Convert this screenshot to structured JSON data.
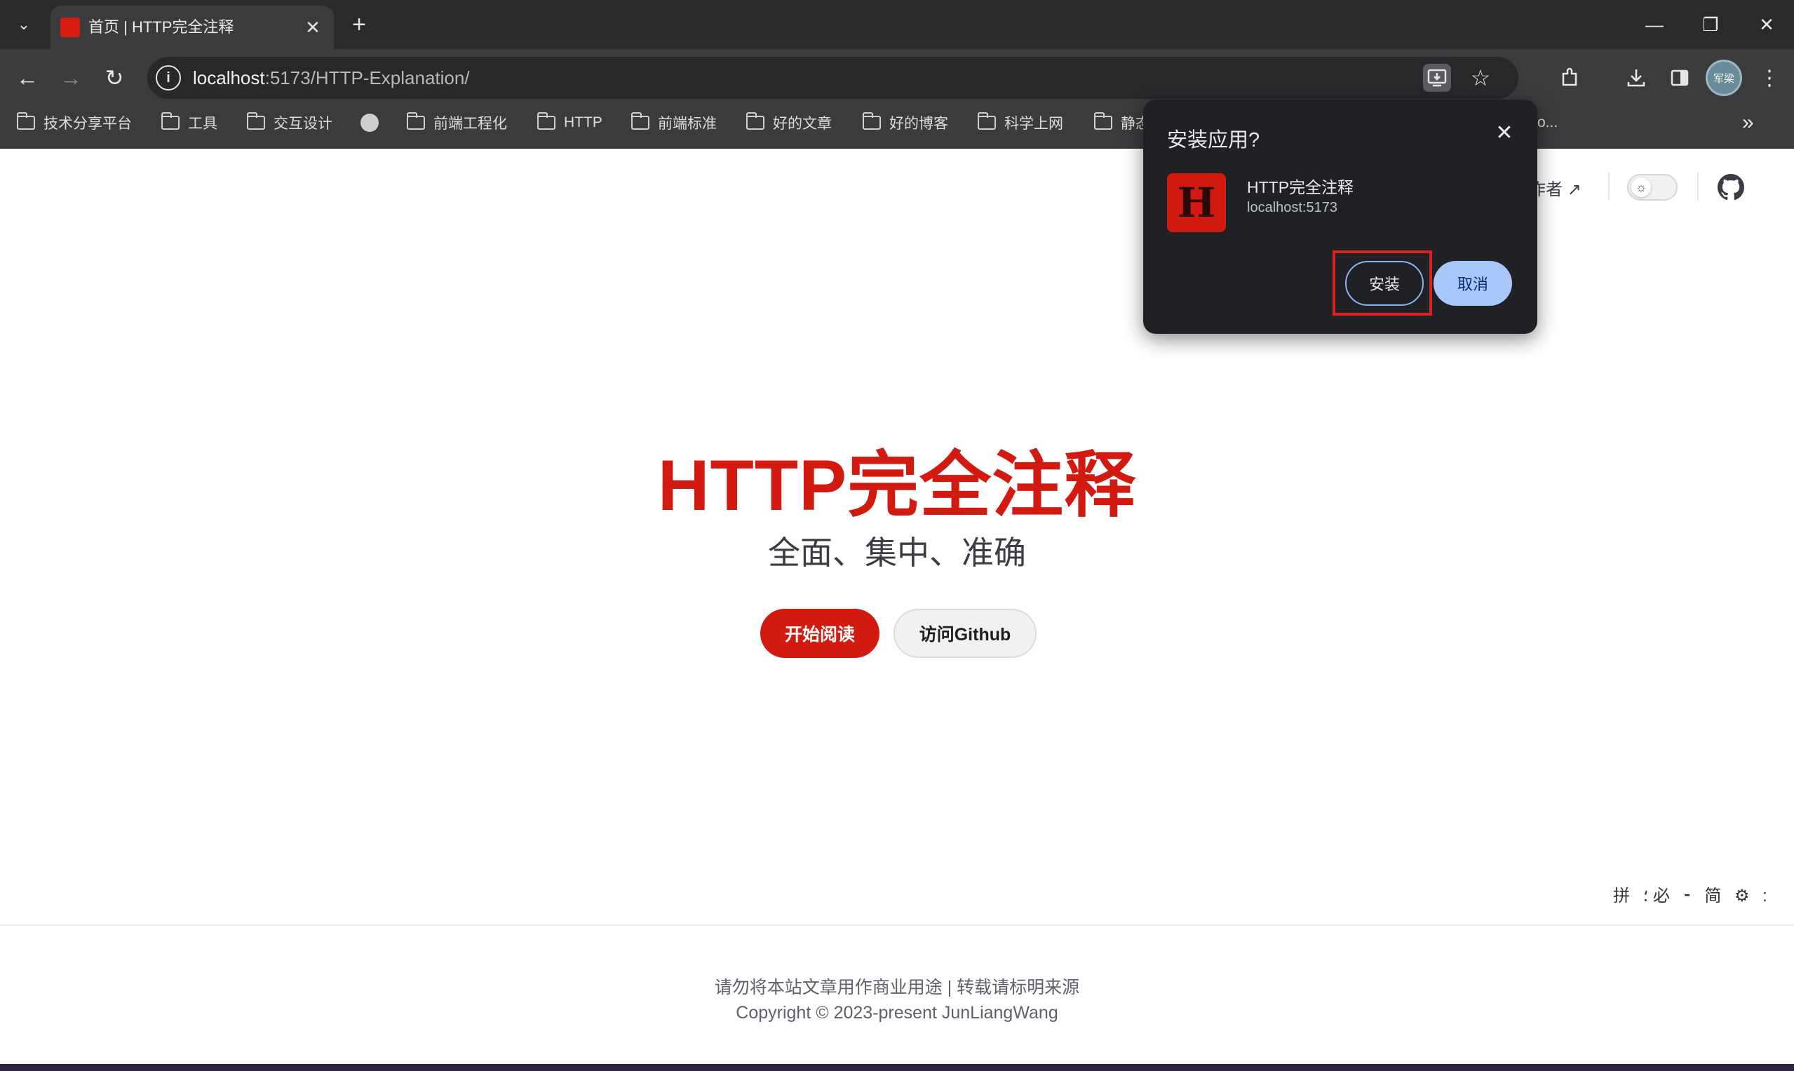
{
  "browser": {
    "tab": {
      "title": "首页 | HTTP完全注释",
      "close": "✕"
    },
    "new_tab": "+",
    "window_controls": {
      "minimize": "—",
      "restore": "❐",
      "close": "✕"
    },
    "nav": {
      "back": "←",
      "forward": "→",
      "reload": "↻"
    },
    "url": {
      "host": "localhost",
      "path": ":5173/HTTP-Explanation/"
    },
    "star": "☆",
    "avatar_text": "军梁",
    "bookmarks": [
      {
        "label": "技术分享平台",
        "icon": "folder-icon"
      },
      {
        "label": "工具",
        "icon": "folder-icon"
      },
      {
        "label": "交互设计",
        "icon": "folder-icon"
      },
      {
        "label": "",
        "icon": "globe-icon"
      },
      {
        "label": "前端工程化",
        "icon": "folder-icon"
      },
      {
        "label": "HTTP",
        "icon": "folder-icon"
      },
      {
        "label": "前端标准",
        "icon": "folder-icon"
      },
      {
        "label": "好的文章",
        "icon": "folder-icon"
      },
      {
        "label": "好的博客",
        "icon": "folder-icon"
      },
      {
        "label": "科学上网",
        "icon": "folder-icon"
      },
      {
        "label": "静态",
        "icon": "folder-icon"
      }
    ],
    "bookmarks_overflow_text": "o...",
    "bookmarks_more": "»"
  },
  "page": {
    "nav_author": "作者 ↗",
    "hero_title": "HTTP完全注释",
    "hero_tagline": "全面、集中、准确",
    "start_button": "开始阅读",
    "github_button": "访问Github",
    "footer_line1": "请勿将本站文章用作商业用途 | 转载请标明来源",
    "footer_line2": "Copyright © 2023-present JunLiangWang",
    "ime_bar": "拼 ؛ 必 ⁃ 简 ⚙ :"
  },
  "install_dialog": {
    "title": "安装应用?",
    "close": "✕",
    "app_icon_letter": "H",
    "app_name": "HTTP完全注释",
    "app_origin": "localhost:5173",
    "install_label": "安装",
    "cancel_label": "取消"
  },
  "colors": {
    "brand_red": "#d21a10",
    "chrome_dark": "#3b3b3e",
    "dialog_bg": "#202124",
    "cancel_blue": "#a8c7fa",
    "highlight_red": "#e02020"
  }
}
